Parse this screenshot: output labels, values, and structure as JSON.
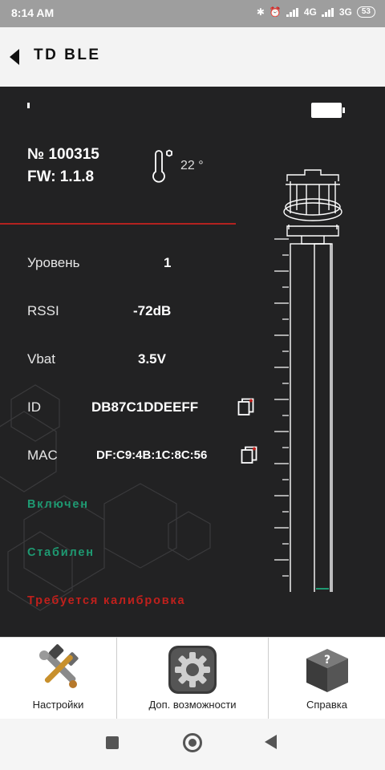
{
  "status_bar": {
    "time": "8:14 AM",
    "network_1": "4G",
    "network_2": "3G",
    "battery": "53"
  },
  "app_bar": {
    "title": "TD BLE"
  },
  "device": {
    "number": "№ 100315",
    "fw": "FW: 1.1.8",
    "temperature": "22 °"
  },
  "rows": {
    "level_label": "Уровень",
    "level_value": "1",
    "rssi_label": "RSSI",
    "rssi_value": "-72dB",
    "vbat_label": "Vbat",
    "vbat_value": "3.5V",
    "id_label": "ID",
    "id_value": "DB87C1DDEEFF",
    "mac_label": "MAC",
    "mac_value": "DF:C9:4B:1C:8C:56"
  },
  "statuses": {
    "on": "Включен",
    "stable": "Стабилен",
    "calibration": "Требуется калибровка"
  },
  "colors": {
    "panel_bg": "#222223",
    "status_ok": "#1e9a72",
    "status_warn": "#c0201c",
    "divider": "#b3221f"
  },
  "bottom_nav": {
    "settings": "Настройки",
    "extra": "Доп. возможности",
    "help": "Справка"
  },
  "icons": [
    "back-icon",
    "thermometer-icon",
    "battery-icon",
    "copy-icon",
    "tools-icon",
    "gear-icon",
    "help-box-icon",
    "recents-icon",
    "home-icon",
    "system-back-icon"
  ]
}
